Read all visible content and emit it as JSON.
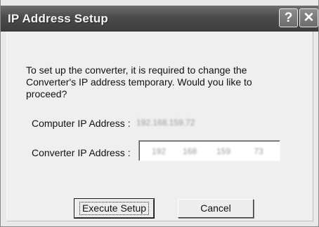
{
  "window": {
    "title": "IP Address Setup",
    "help_glyph": "?",
    "close_glyph": "✕"
  },
  "dialog": {
    "message": "To set up the converter, it is required to change the Converter's IP address temporary.  Would you like to proceed?",
    "computer_ip_label": "Computer IP Address :",
    "computer_ip_value": "192.168.159.72",
    "converter_ip_label": "Converter IP Address :",
    "converter_ip_octets": [
      "192",
      "168",
      "159",
      "73"
    ]
  },
  "buttons": {
    "execute_label": "Execute Setup",
    "cancel_label": "Cancel"
  },
  "colors": {
    "titlebar": "#4b4b4b",
    "background": "#efefef"
  },
  "icons": {
    "help": "help-icon",
    "close": "close-icon"
  }
}
